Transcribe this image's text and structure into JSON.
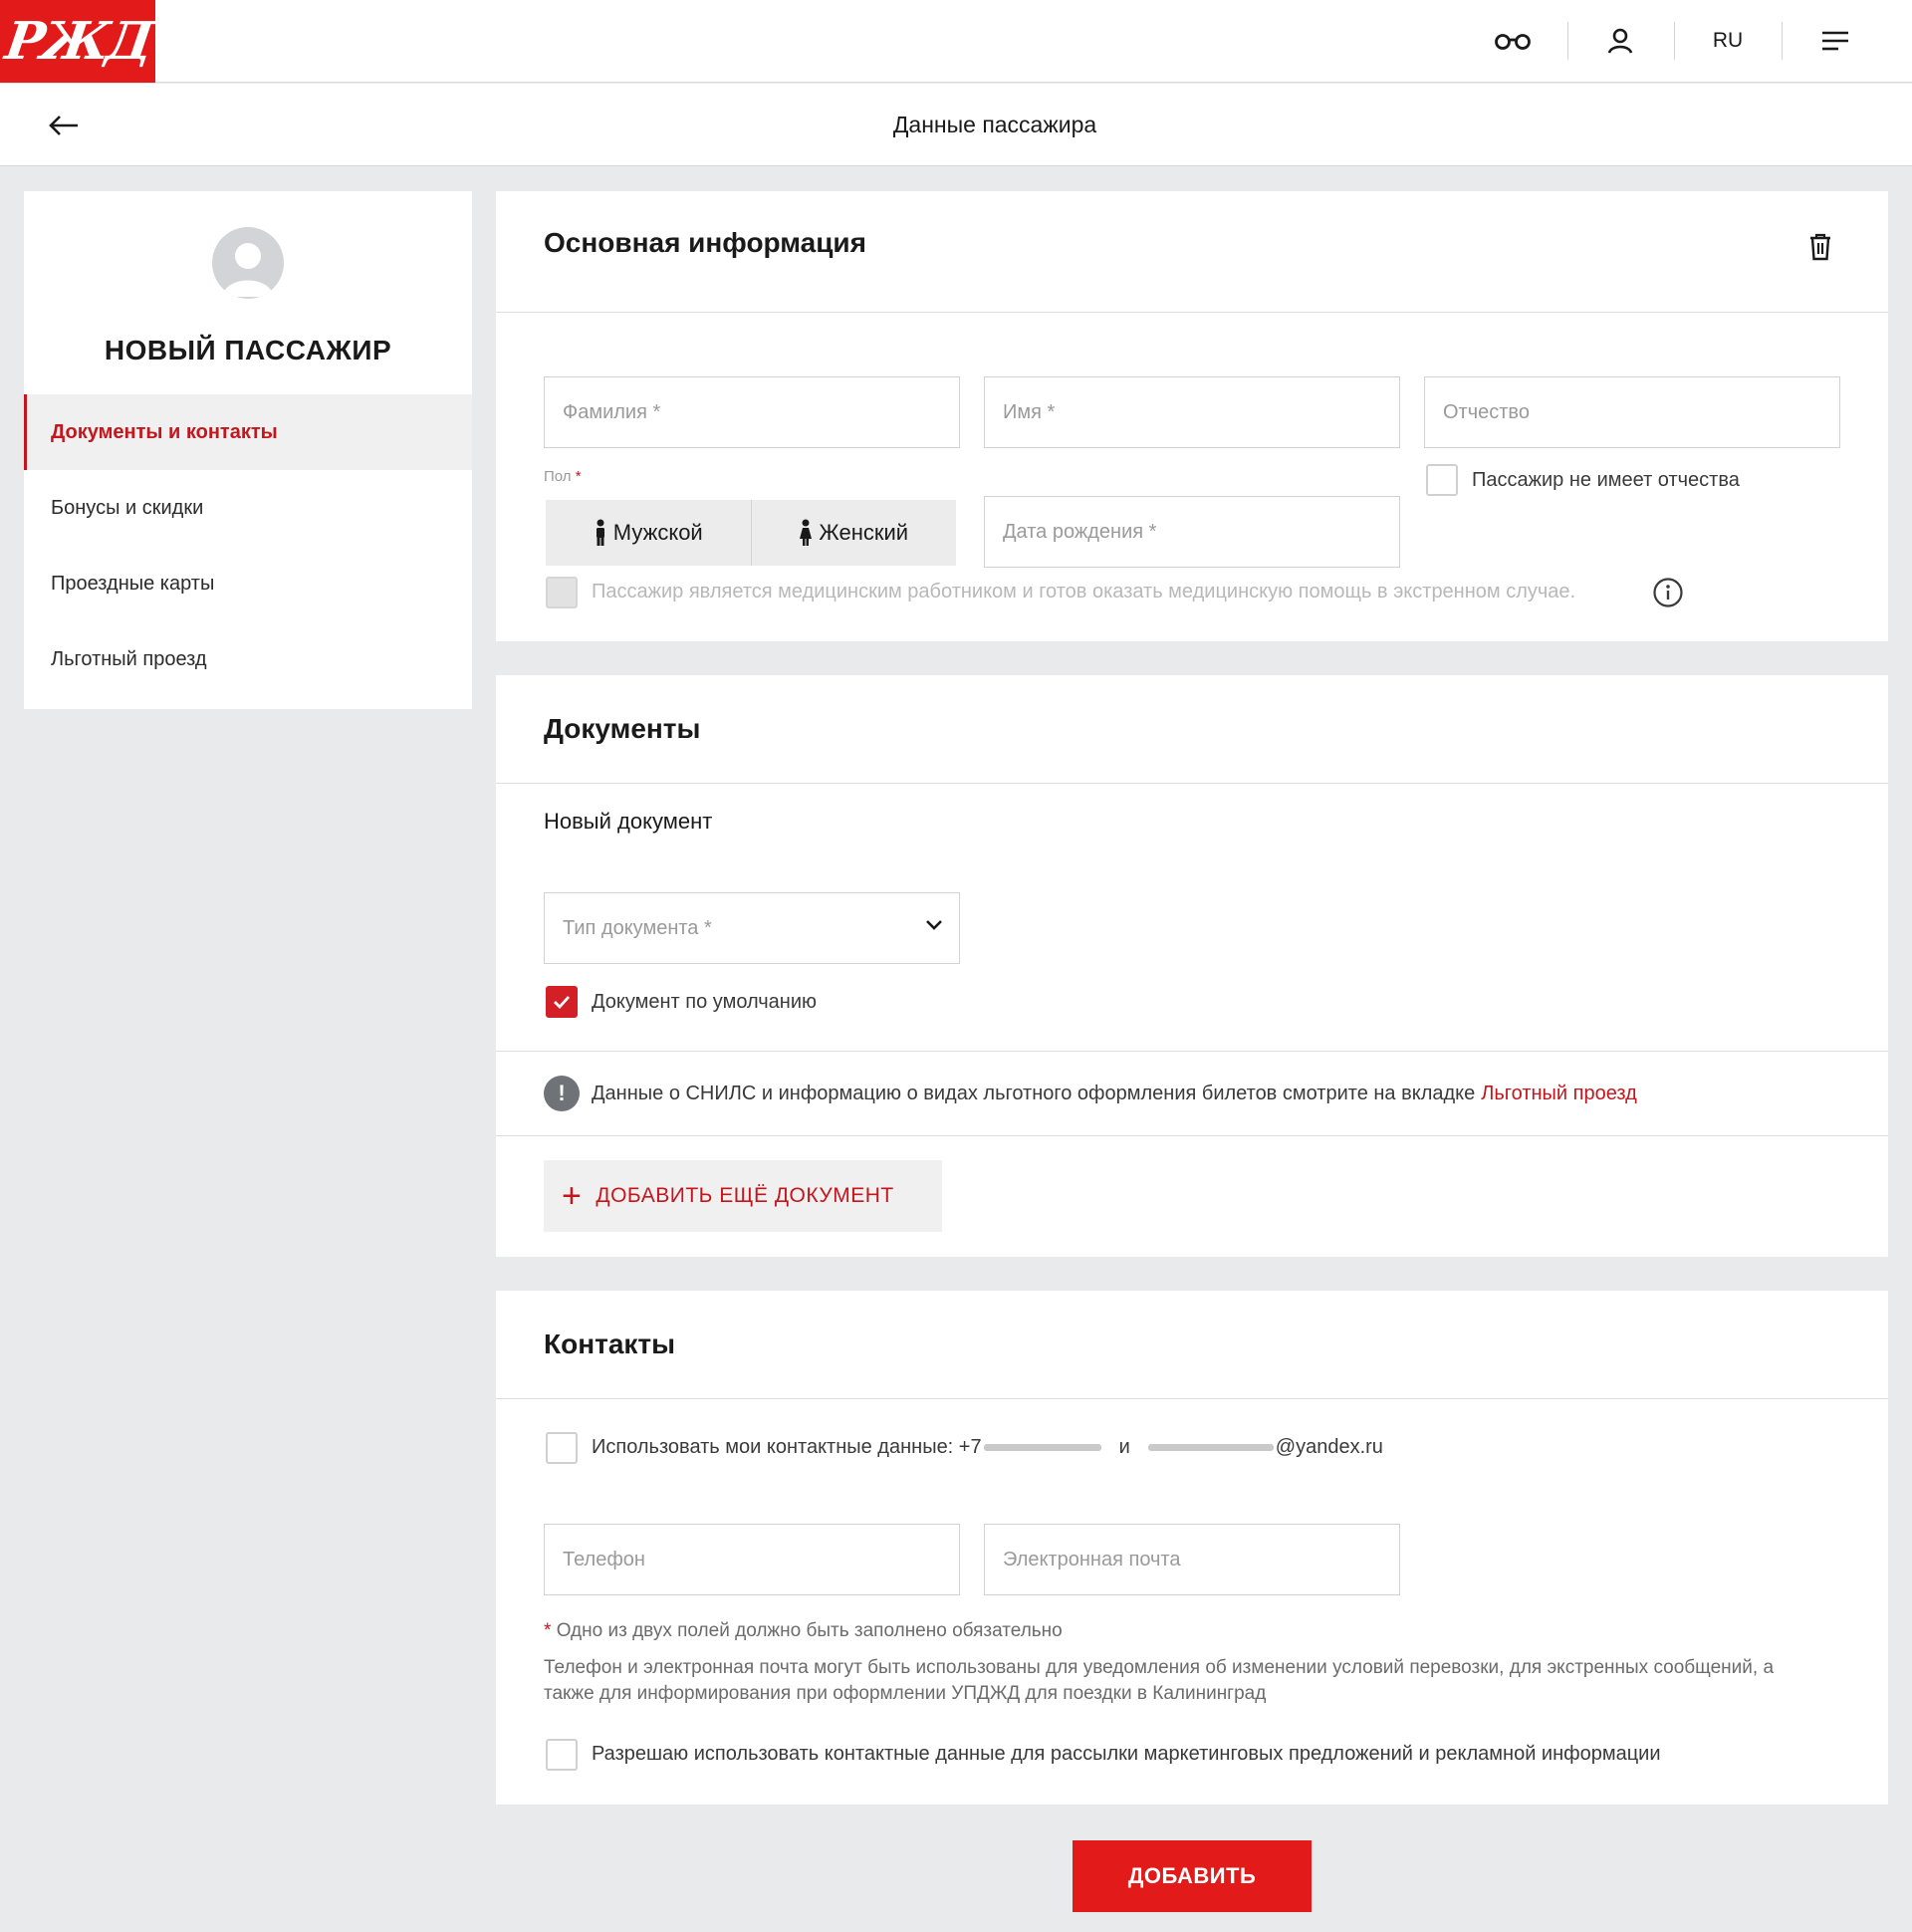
{
  "header": {
    "logo_text": "РЖД",
    "lang": "RU",
    "icons": [
      "glasses-icon",
      "user-icon",
      "menu-icon"
    ],
    "brand_color": "#e21a1a"
  },
  "subheader": {
    "title": "Данные пассажира"
  },
  "sidebar": {
    "title": "НОВЫЙ ПАССАЖИР",
    "items": [
      {
        "label": "Документы и контакты",
        "active": true
      },
      {
        "label": "Бонусы и скидки"
      },
      {
        "label": "Проездные карты"
      },
      {
        "label": "Льготный проезд"
      }
    ]
  },
  "basic": {
    "title": "Основная информация",
    "lastname_placeholder": "Фамилия *",
    "firstname_placeholder": "Имя *",
    "patronymic_placeholder": "Отчество",
    "no_patronymic_label": "Пассажир не имеет отчества",
    "gender_label": "Пол",
    "gender_req": "*",
    "male": "Мужской",
    "female": "Женский",
    "birthdate_placeholder": "Дата рождения *",
    "medical_label": "Пассажир является медицинским работником и готов оказать медицинскую помощь в экстренном случае."
  },
  "documents": {
    "title": "Документы",
    "new_doc": "Новый документ",
    "doc_type_placeholder": "Тип документа *",
    "default_doc_label": "Документ по умолчанию",
    "default_doc_checked": true,
    "info_text": "Данные о СНИЛС и информацию о видах льготного оформления билетов смотрите на вкладке",
    "info_link": "Льготный проезд",
    "add_button": "ДОБАВИТЬ ЕЩЁ ДОКУМЕНТ"
  },
  "contacts": {
    "title": "Контакты",
    "use_my_label": "Использовать мои контактные данные: +7",
    "and": "и",
    "email_suffix": "@yandex.ru",
    "phone_placeholder": "Телефон",
    "email_placeholder": "Электронная почта",
    "required_note_star": "*",
    "required_note": "Одно из двух полей должно быть заполнено обязательно",
    "usage_note": "Телефон и электронная почта могут быть использованы для уведомления об изменении условий перевозки, для экстренных сообщений, а также для информирования при оформлении УПДЖД для поездки в Калининград",
    "marketing_label": "Разрешаю использовать контактные данные для рассылки маркетинговых предложений и рекламной информации"
  },
  "submit_label": "ДОБАВИТЬ"
}
